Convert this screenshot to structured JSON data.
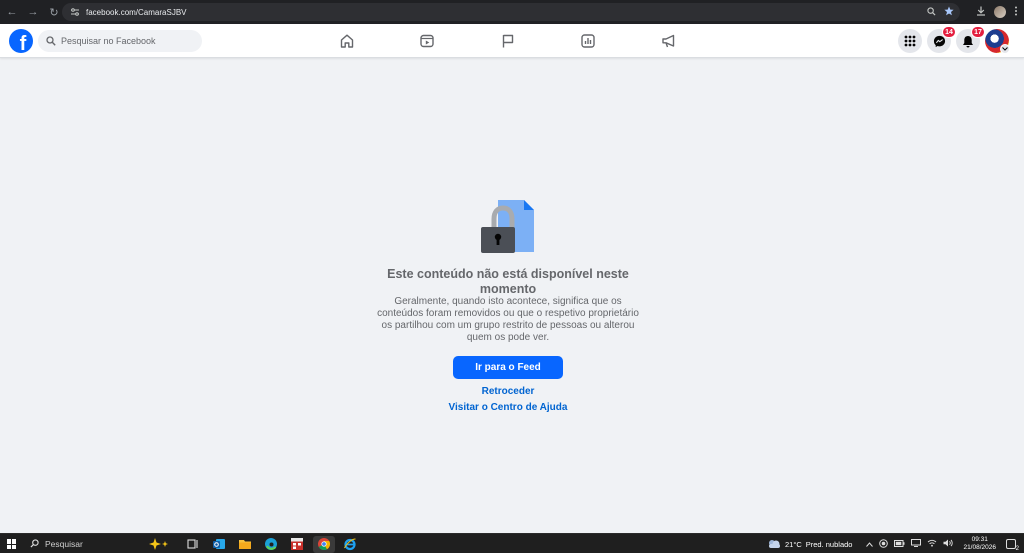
{
  "browser": {
    "url": "facebook.com/CamaraSJBV",
    "back_label": "←",
    "forward_label": "→",
    "reload_label": "↻"
  },
  "header": {
    "logo_letter": "f",
    "search_placeholder": "Pesquisar no Facebook",
    "messenger_badge": "14",
    "notifications_badge": "17",
    "brand_color": "#0866ff",
    "badge_color": "#e41e3f"
  },
  "main": {
    "title_line1": "Este conteúdo não está disponível neste",
    "title_line2": "momento",
    "desc_line1": "Geralmente, quando isto acontece, significa que os",
    "desc_line2": "conteúdos foram removidos ou que o respetivo proprietário",
    "desc_line3": "os partilhou com um grupo restrito de pessoas ou alterou",
    "desc_line4": "quem os pode ver.",
    "primary_button": "Ir para o Feed",
    "link_back": "Retroceder",
    "link_help": "Visitar o Centro de Ajuda"
  },
  "taskbar": {
    "search_label": "Pesquisar",
    "temperature": "21°C",
    "weather_text": "Pred. nublado",
    "time": "09:31",
    "date": "21/08/2026",
    "notification_count": "2"
  },
  "icons": [
    "home-icon",
    "video-icon",
    "flag-icon",
    "dashboard-icon",
    "megaphone-icon",
    "menu-grid-icon",
    "messenger-icon",
    "bell-icon",
    "lock-icon"
  ]
}
